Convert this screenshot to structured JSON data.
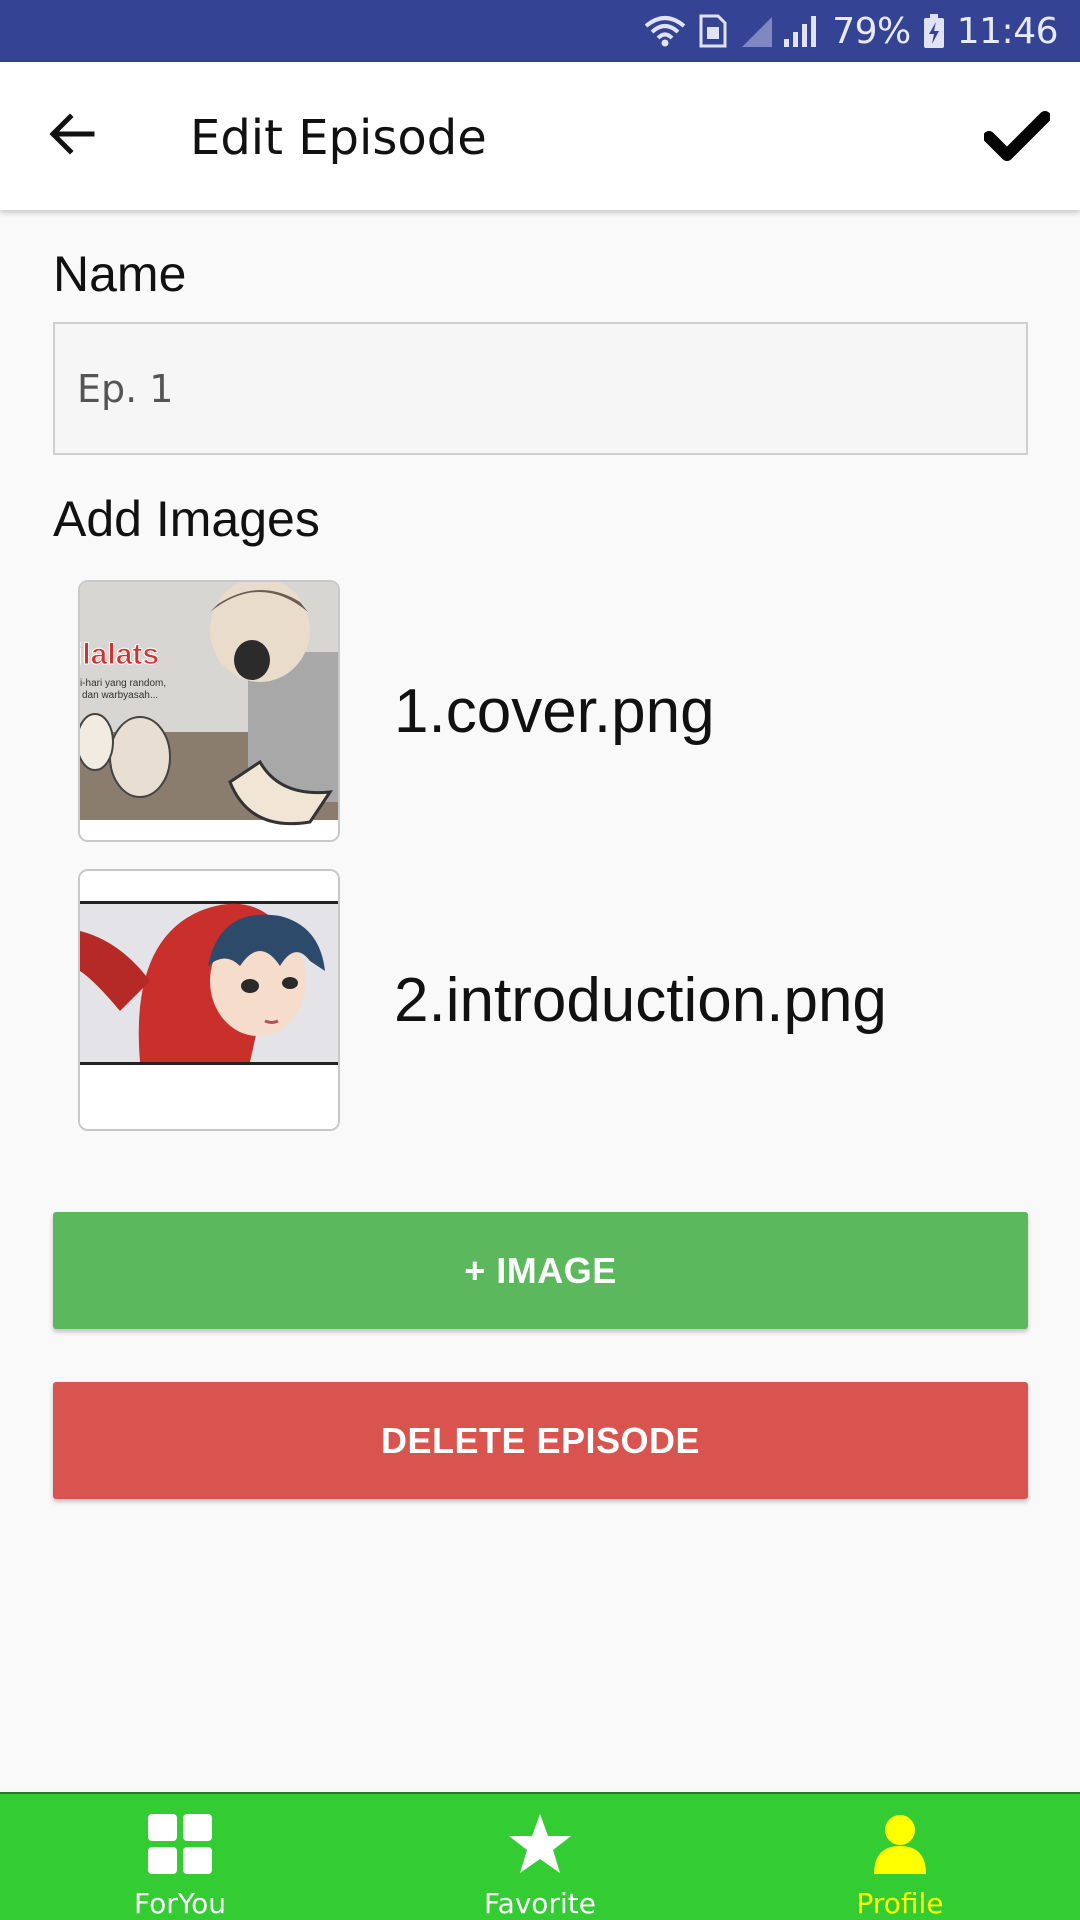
{
  "status_bar": {
    "battery": "79%",
    "time": "11:46",
    "icons": [
      "wifi-icon",
      "sim-icon",
      "signal-icon",
      "battery-icon"
    ]
  },
  "app_bar": {
    "title": "Edit Episode",
    "back_icon": "arrow-left-icon",
    "confirm_icon": "check-icon"
  },
  "form": {
    "name_label": "Name",
    "name_value": "Ep. 1",
    "add_images_label": "Add Images"
  },
  "images": [
    {
      "file_name": "1.cover.png",
      "thumb_text": "ilalats",
      "thumb_sub1": "i-hari yang random,",
      "thumb_sub2": "dan warbyasah..."
    },
    {
      "file_name": "2.introduction.png"
    }
  ],
  "buttons": {
    "add_image": "+ IMAGE",
    "delete_episode": "DELETE EPISODE"
  },
  "bottom_nav": {
    "items": [
      {
        "label": "ForYou",
        "icon": "grid-icon"
      },
      {
        "label": "Favorite",
        "icon": "star-icon"
      },
      {
        "label": "Profile",
        "icon": "person-icon"
      }
    ],
    "active": "Profile"
  },
  "colors": {
    "status_bar": "#354394",
    "add_button": "#5cb85c",
    "delete_button": "#d9534f",
    "bottom_nav": "#33cc33",
    "nav_active": "#ffff00"
  }
}
